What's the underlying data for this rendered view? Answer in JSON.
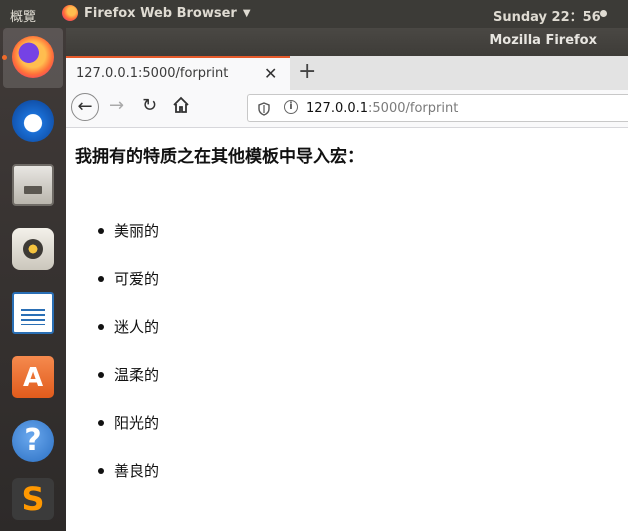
{
  "top_panel": {
    "activities": "概覽",
    "app_name": "Firefox Web Browser",
    "clock": "Sunday 22：56"
  },
  "window": {
    "title": "Mozilla Firefox"
  },
  "dock": {
    "items": [
      {
        "icon": "firefox-icon"
      },
      {
        "icon": "thunderbird-icon"
      },
      {
        "icon": "files-icon"
      },
      {
        "icon": "rhythmbox-icon"
      },
      {
        "icon": "libreoffice-writer-icon"
      },
      {
        "icon": "software-store-icon",
        "glyph": "A"
      },
      {
        "icon": "help-icon",
        "glyph": "?"
      },
      {
        "icon": "sublime-text-icon",
        "glyph": "S"
      }
    ]
  },
  "browser": {
    "tab_title": "127.0.0.1:5000/forprint",
    "new_tab": "+",
    "url_host": "127.0.0.1",
    "url_path": ":5000/forprint"
  },
  "page": {
    "heading": "我拥有的特质之在其他模板中导入宏：",
    "items": [
      "美丽的",
      "可爱的",
      "迷人的",
      "温柔的",
      "阳光的",
      "善良的"
    ]
  }
}
